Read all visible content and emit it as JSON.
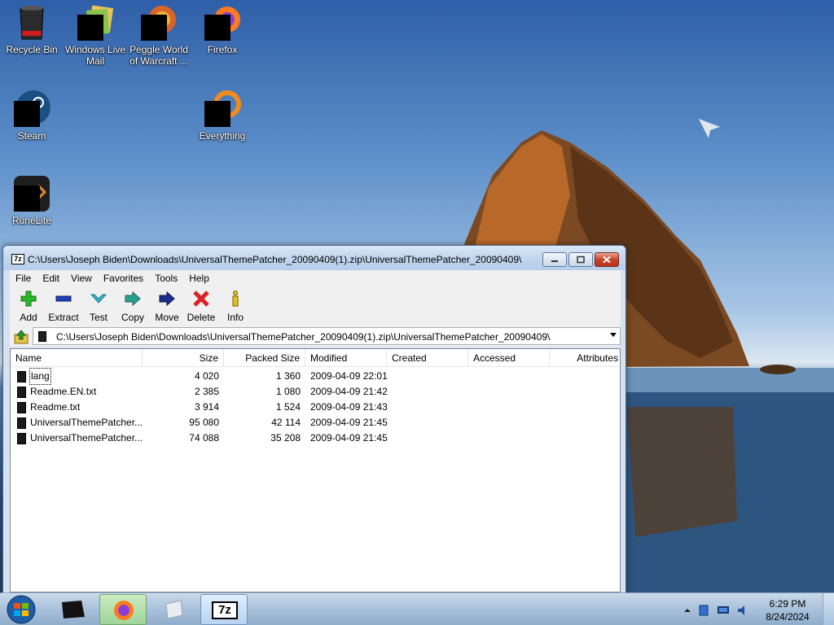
{
  "desktop": {
    "icons": [
      {
        "label": "Recycle Bin",
        "icon": "recycle-bin-icon"
      },
      {
        "label": "Windows Live Mail",
        "icon": "mail-icon"
      },
      {
        "label": "Peggle World of Warcraft ...",
        "icon": "peggle-icon"
      },
      {
        "label": "Firefox",
        "icon": "firefox-icon"
      },
      {
        "label": "Steam",
        "icon": "steam-icon"
      },
      {
        "label": "Everything",
        "icon": "everything-icon"
      },
      {
        "label": "RuneLite",
        "icon": "runelite-icon"
      }
    ]
  },
  "window": {
    "app_badge": "7z",
    "title": "C:\\Users\\Joseph Biden\\Downloads\\UniversalThemePatcher_20090409(1).zip\\UniversalThemePatcher_20090409\\",
    "menu": [
      "File",
      "Edit",
      "View",
      "Favorites",
      "Tools",
      "Help"
    ],
    "toolbar": [
      {
        "label": "Add",
        "icon": "plus-icon",
        "color": "#2bb52b"
      },
      {
        "label": "Extract",
        "icon": "minus-icon",
        "color": "#1f3fb4"
      },
      {
        "label": "Test",
        "icon": "check-down-icon",
        "color": "#39b3c9"
      },
      {
        "label": "Copy",
        "icon": "double-arrow-right-icon",
        "color": "#2a9f8f"
      },
      {
        "label": "Move",
        "icon": "arrow-right-icon",
        "color": "#1b2f8a"
      },
      {
        "label": "Delete",
        "icon": "x-icon",
        "color": "#d92222"
      },
      {
        "label": "Info",
        "icon": "info-icon",
        "color": "#e6c31a"
      }
    ],
    "address": "C:\\Users\\Joseph Biden\\Downloads\\UniversalThemePatcher_20090409(1).zip\\UniversalThemePatcher_20090409\\",
    "columns": [
      "Name",
      "Size",
      "Packed Size",
      "Modified",
      "Created",
      "Accessed",
      "Attributes"
    ],
    "rows": [
      {
        "name": "lang",
        "size": "4 020",
        "packed": "1 360",
        "modified": "2009-04-09 22:01",
        "selected": true
      },
      {
        "name": "Readme.EN.txt",
        "size": "2 385",
        "packed": "1 080",
        "modified": "2009-04-09 21:42"
      },
      {
        "name": "Readme.txt",
        "size": "3 914",
        "packed": "1 524",
        "modified": "2009-04-09 21:43"
      },
      {
        "name": "UniversalThemePatcher...",
        "size": "95 080",
        "packed": "42 114",
        "modified": "2009-04-09 21:45"
      },
      {
        "name": "UniversalThemePatcher...",
        "size": "74 088",
        "packed": "35 208",
        "modified": "2009-04-09 21:45"
      }
    ]
  },
  "taskbar": {
    "tasks": [
      {
        "name": "taskbar-dark-app",
        "icon": "dark-box-icon"
      },
      {
        "name": "taskbar-firefox",
        "icon": "firefox-icon"
      },
      {
        "name": "taskbar-roblox",
        "icon": "roblox-icon"
      },
      {
        "name": "taskbar-7zip",
        "icon": "7zip-icon",
        "badge": "7z"
      }
    ],
    "clock_time": "6:29 PM",
    "clock_date": "8/24/2024"
  }
}
